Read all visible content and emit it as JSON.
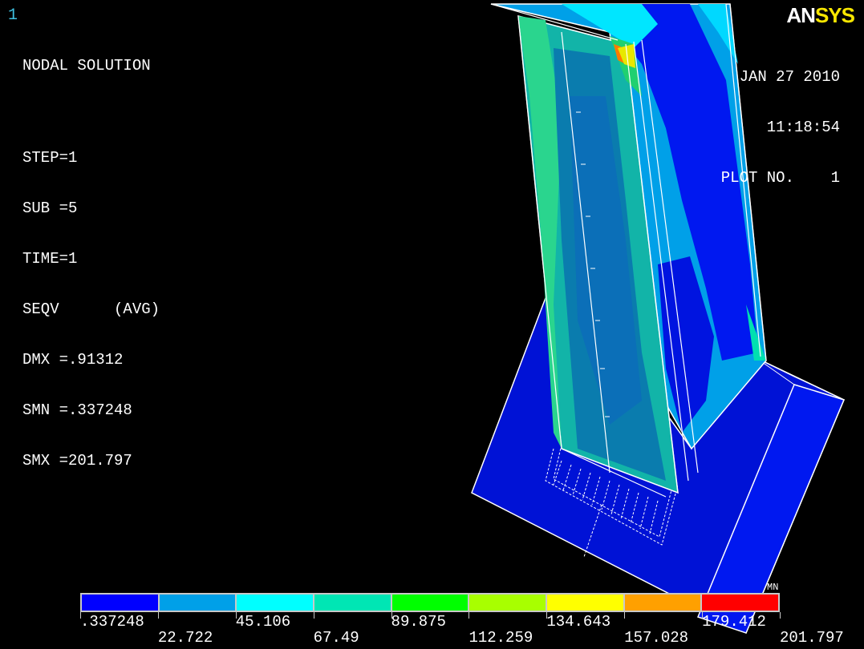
{
  "window_number": "1",
  "logo": {
    "an": "AN",
    "sys": "SYS"
  },
  "info": {
    "title": "NODAL SOLUTION",
    "step": "STEP=1",
    "sub": "SUB =5",
    "time": "TIME=1",
    "seqv": "SEQV      (AVG)",
    "dmx": "DMX =.91312",
    "smn": "SMN =.337248",
    "smx": "SMX =201.797"
  },
  "date": {
    "date": "JAN 27 2010",
    "time": "11:18:54",
    "plot": "PLOT NO.    1"
  },
  "legend": {
    "unit": "MN",
    "colors": [
      "#0000ff",
      "#00a0e8",
      "#00ffff",
      "#00e6b4",
      "#00ff00",
      "#a8ff00",
      "#ffff00",
      "#ffa000",
      "#ff0000"
    ],
    "labels_top": [
      ".337248",
      "45.106",
      "89.875",
      "134.643",
      "179.412"
    ],
    "labels_bottom": [
      "22.722",
      "67.49",
      "112.259",
      "157.028",
      "201.797"
    ]
  },
  "colors": {
    "background": "#000000",
    "edge": "#ffffff",
    "dark_blue": "#0012d6",
    "mid_blue": "#0a9be0",
    "cyan": "#00e6ff",
    "teal": "#12b4a8",
    "green": "#2ad58e"
  }
}
